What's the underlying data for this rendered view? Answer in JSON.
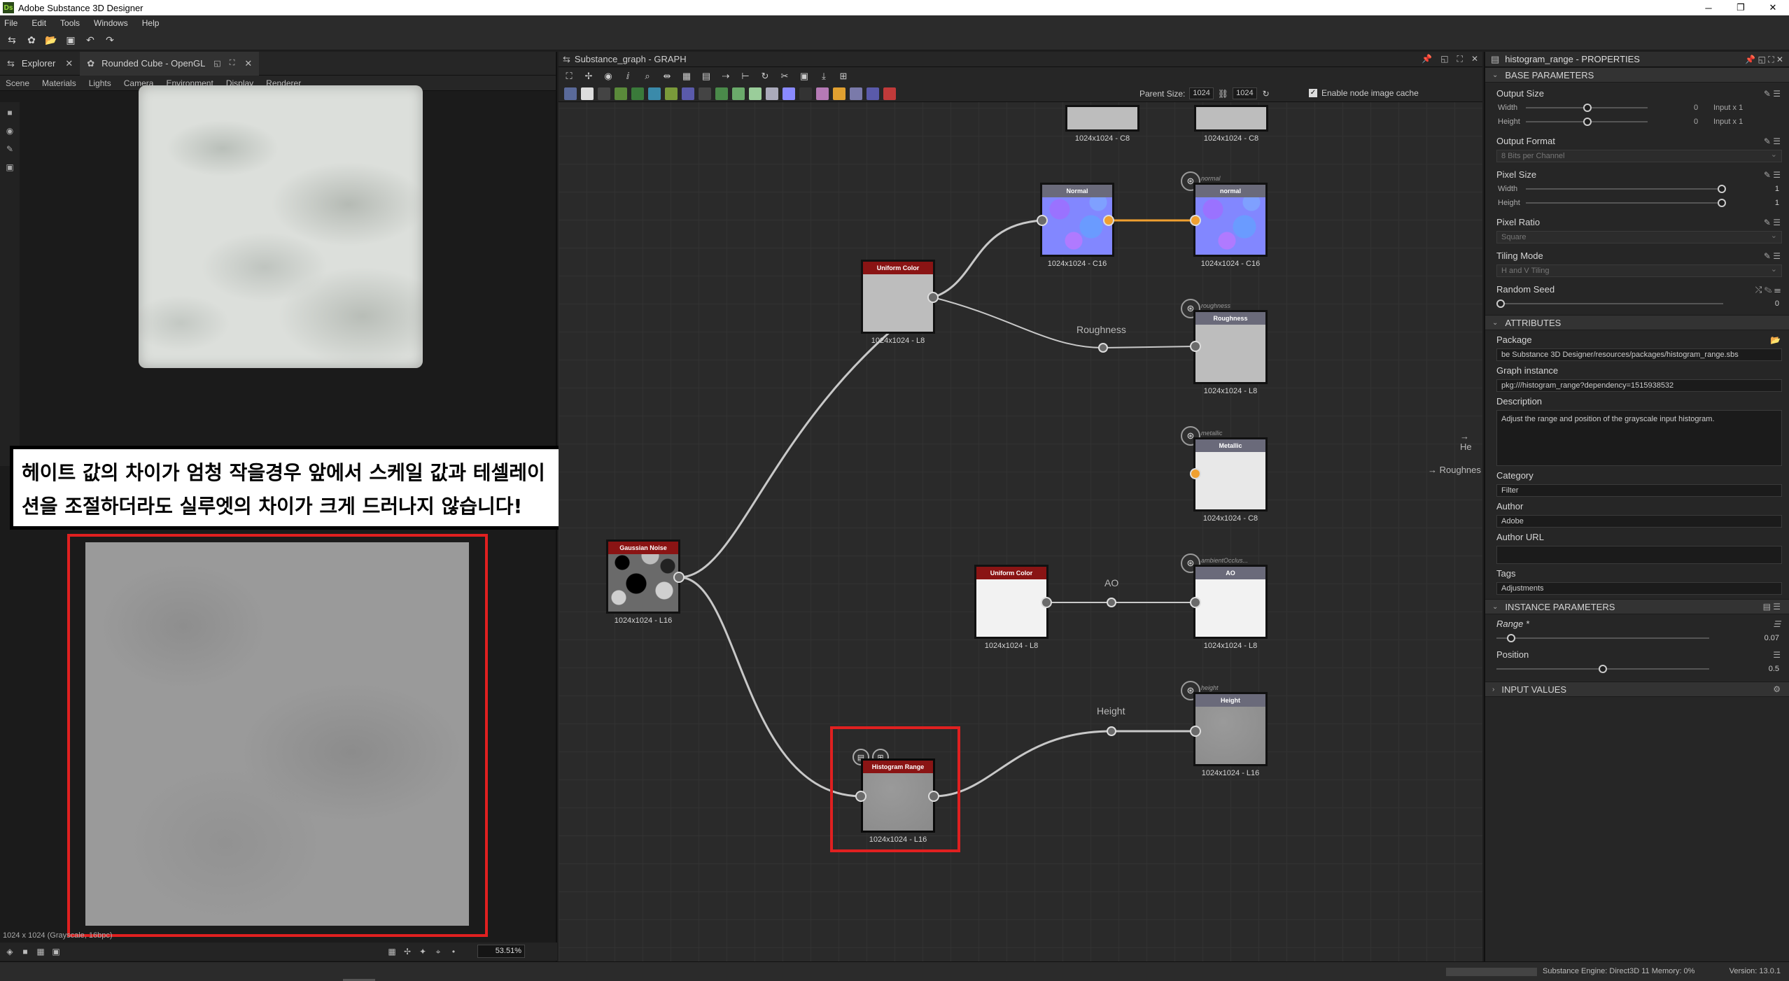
{
  "window": {
    "title": "Adobe Substance 3D Designer",
    "app_badge": "Ds"
  },
  "menu": [
    "File",
    "Edit",
    "Tools",
    "Windows",
    "Help"
  ],
  "viewport": {
    "tabs": [
      {
        "label": "Explorer"
      },
      {
        "label": "Rounded Cube - OpenGL"
      }
    ],
    "subtabs": [
      "Scene",
      "Materials",
      "Lights",
      "Camera",
      "Environment",
      "Display",
      "Renderer"
    ],
    "caption_line1": "헤이트 값의 차이가 엄청 작을경우 앞에서 스케일 값과 테셀레이",
    "caption_line2": "션을 조절하더라도 실루엣의 차이가 크게 드러나지 않습니다!",
    "image_info": "1024 x 1024 (Grayscale, 16bpc)",
    "zoom": "53.51%"
  },
  "graph": {
    "title": "Substance_graph - GRAPH",
    "parent_size_label": "Parent Size:",
    "parent_size_a": "1024",
    "parent_size_b": "1024",
    "cache_label": "Enable node image cache",
    "nodes": {
      "top1": {
        "label": "1024x1024 - C8"
      },
      "top2": {
        "label": "1024x1024 - C8"
      },
      "normal": {
        "title": "Normal",
        "label": "1024x1024 - C16"
      },
      "normal_out": {
        "title": "normal",
        "id": "normal",
        "label": "1024x1024 - C16"
      },
      "uniform1": {
        "title": "Uniform Color",
        "label": "1024x1024 - L8"
      },
      "roughness_out": {
        "title": "Roughness",
        "id": "roughness",
        "label": "1024x1024 - L8"
      },
      "metallic_out": {
        "title": "Metallic",
        "id": "metallic",
        "label": "1024x1024 - C8"
      },
      "gaussian": {
        "title": "Gaussian Noise",
        "label": "1024x1024 - L16"
      },
      "uniform2": {
        "title": "Uniform Color",
        "label": "1024x1024 - L8"
      },
      "ao_out": {
        "title": "AO",
        "id": "ambientOcclus...",
        "label": "1024x1024 - L8"
      },
      "height_out": {
        "title": "Height",
        "id": "height",
        "label": "1024x1024 - L16"
      },
      "histogram": {
        "title": "Histogram Range",
        "label": "1024x1024 - L16"
      }
    },
    "dots": {
      "roughness": "Roughness",
      "ao": "AO",
      "height": "Height"
    },
    "edge_labels": {
      "he": "→ He",
      "roughness": "→ Roughnes"
    }
  },
  "properties": {
    "title": "histogram_range - PROPERTIES",
    "sections": {
      "base": "BASE PARAMETERS",
      "attributes": "ATTRIBUTES",
      "instance": "INSTANCE PARAMETERS",
      "input": "INPUT VALUES"
    },
    "output_size": {
      "label": "Output Size",
      "width_label": "Width",
      "height_label": "Height",
      "width_val": "0",
      "height_val": "0",
      "width_mode": "Input x 1",
      "height_mode": "Input x 1"
    },
    "output_format": {
      "label": "Output Format",
      "value": "8 Bits per Channel"
    },
    "pixel_size": {
      "label": "Pixel Size",
      "width_label": "Width",
      "height_label": "Height",
      "width_val": "1",
      "height_val": "1"
    },
    "pixel_ratio": {
      "label": "Pixel Ratio",
      "value": "Square"
    },
    "tiling_mode": {
      "label": "Tiling Mode",
      "value": "H and V Tiling"
    },
    "random_seed": {
      "label": "Random Seed",
      "value": "0"
    },
    "package": {
      "label": "Package",
      "value": "be Substance 3D Designer/resources/packages/histogram_range.sbs"
    },
    "graph_instance": {
      "label": "Graph instance",
      "value": "pkg:///histogram_range?dependency=1515938532"
    },
    "description": {
      "label": "Description",
      "value": "Adjust the range and position of the grayscale input histogram."
    },
    "category": {
      "label": "Category",
      "value": "Filter"
    },
    "author": {
      "label": "Author",
      "value": "Adobe"
    },
    "author_url": {
      "label": "Author URL",
      "value": ""
    },
    "tags": {
      "label": "Tags",
      "value": "Adjustments"
    },
    "range": {
      "label": "Range *",
      "value": "0.07",
      "fraction": 0.07
    },
    "position": {
      "label": "Position",
      "value": "0.5",
      "fraction": 0.5
    }
  },
  "status": {
    "engine": "Substance Engine: Direct3D 11  Memory: 0%",
    "version": "Version: 13.0.1"
  }
}
